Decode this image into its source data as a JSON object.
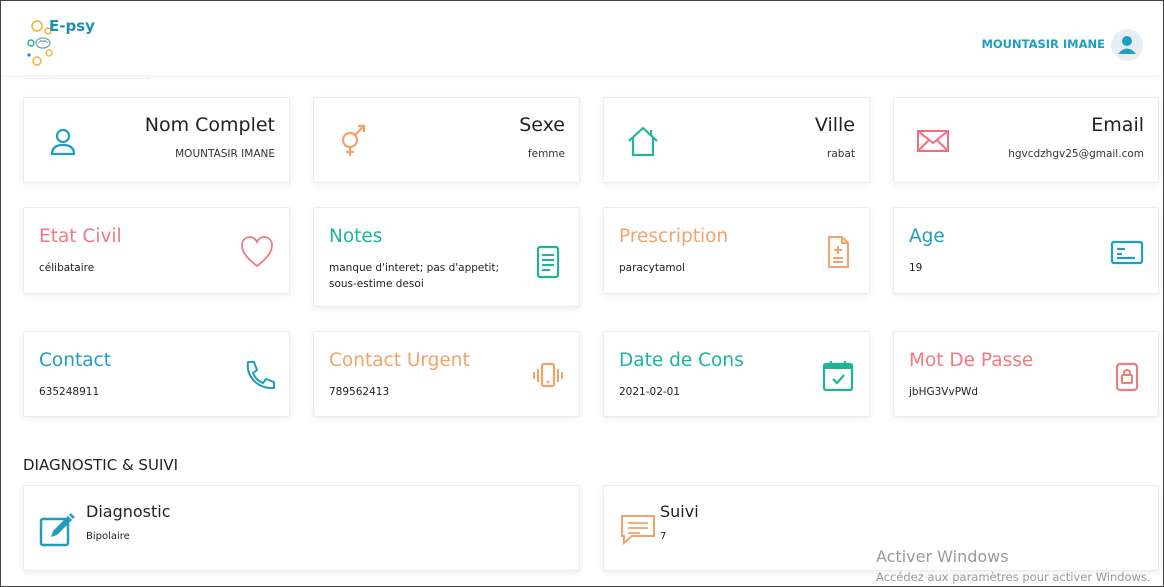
{
  "header": {
    "brand": "E-psy",
    "user_name": "MOUNTASIR IMANE",
    "brand_color": "#1f8fb0",
    "accent_color": "#22a4b4"
  },
  "info_cards": [
    {
      "title": "Nom Complet",
      "value": "MOUNTASIR IMANE",
      "icon": "user-icon",
      "color": "#1f9ec2"
    },
    {
      "title": "Sexe",
      "value": "femme",
      "icon": "gender-icon",
      "color": "#f0a36b"
    },
    {
      "title": "Ville",
      "value": "rabat",
      "icon": "home-icon",
      "color": "#22b39a"
    },
    {
      "title": "Email",
      "value": "hgvcdzhgv25@gmail.com",
      "icon": "mail-icon",
      "color": "#ef6f7e"
    }
  ],
  "detail_cards": [
    {
      "title": "Etat Civil",
      "value": "célibataire",
      "icon": "heart-icon",
      "color": "#ef7a80"
    },
    {
      "title": "Notes",
      "value": "manque d'interet; pas d'appetit; sous-estime desoi",
      "icon": "document-icon",
      "color": "#1fb39a"
    },
    {
      "title": "Prescription",
      "value": "paracytamol",
      "icon": "prescription-icon",
      "color": "#f2a36b"
    },
    {
      "title": "Age",
      "value": "19",
      "icon": "id-card-icon",
      "color": "#1f9ec2"
    },
    {
      "title": "Contact",
      "value": "635248911",
      "icon": "phone-icon",
      "color": "#1f9ec2"
    },
    {
      "title": "Contact Urgent",
      "value": "789562413",
      "icon": "vibrating-phone-icon",
      "color": "#f2a36b"
    },
    {
      "title": "Date de Cons",
      "value": "2021-02-01",
      "icon": "calendar-icon",
      "color": "#1fb39a"
    },
    {
      "title": "Mot De Passe",
      "value": "jbHG3VvPWd",
      "icon": "lock-icon",
      "color": "#ef7a80"
    }
  ],
  "section": {
    "title": "DIAGNOSTIC & SUIVI"
  },
  "followup_cards": [
    {
      "title": "Diagnostic",
      "value": "Bipolaire",
      "icon": "edit-icon",
      "color": "#1f9ec2"
    },
    {
      "title": "Suivi",
      "value": "7",
      "icon": "chat-icon",
      "color": "#f2a36b"
    }
  ],
  "watermark": {
    "title": "Activer Windows",
    "subtitle": "Accédez aux paramètres pour activer Windows."
  }
}
